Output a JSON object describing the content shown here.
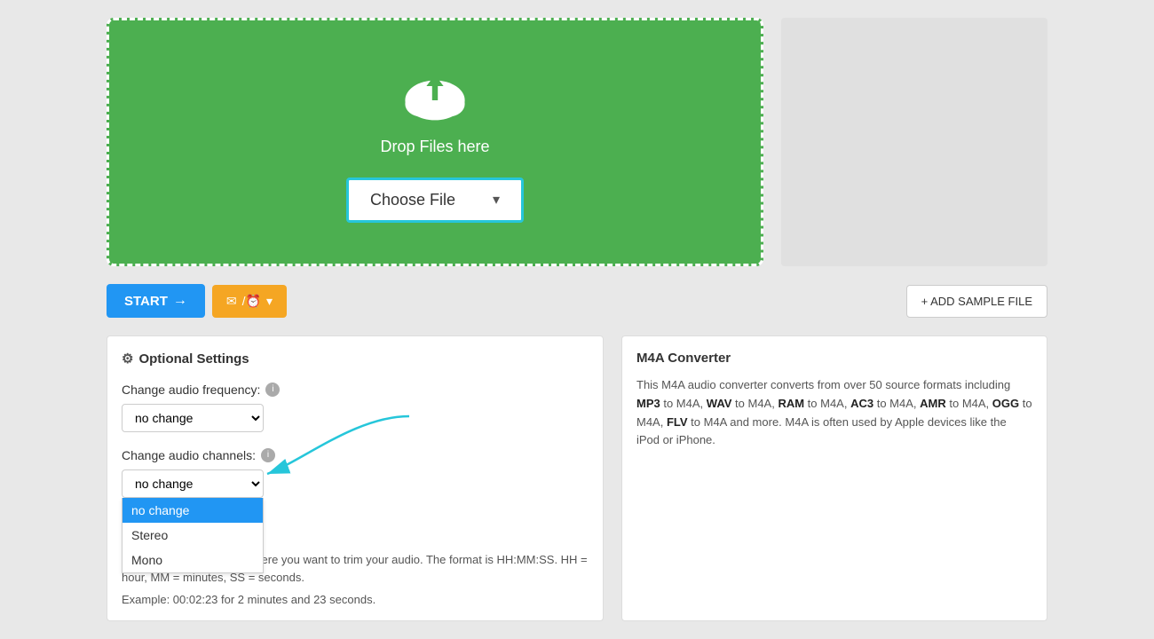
{
  "upload": {
    "drop_text": "Drop Files here",
    "choose_file_label": "Choose File",
    "border_color": "#26c6da",
    "bg_color": "#4caf50"
  },
  "actions": {
    "start_label": "START",
    "add_sample_label": "+ ADD SAMPLE FILE"
  },
  "settings": {
    "title": "Optional Settings",
    "frequency_label": "Change audio frequency:",
    "frequency_default": "no change",
    "channels_label": "Change audio channels:",
    "channels_default": "no change",
    "channels_options": [
      "no change",
      "Stereo",
      "Mono"
    ],
    "channels_selected": "no change",
    "timestamp_info": "Enter the timestamps of where you want to trim your audio. The format is HH:MM:SS. HH = hour, MM = minutes, SS = seconds.",
    "timestamp_example": "Example: 00:02:23 for 2 minutes and 23 seconds."
  },
  "converter_info": {
    "title": "M4A Converter",
    "text_parts": [
      "This M4A audio converter converts from over 50 source formats including ",
      "MP3",
      " to M4A, ",
      "WAV",
      " to M4A, ",
      "RAM",
      " to M4A, ",
      "AC3",
      " to M4A, ",
      "AMR",
      " to M4A, ",
      "OGG",
      " to M4A, ",
      "FLV",
      " to M4A and more. M4A is often used by Apple devices like the iPod or iPhone."
    ]
  }
}
